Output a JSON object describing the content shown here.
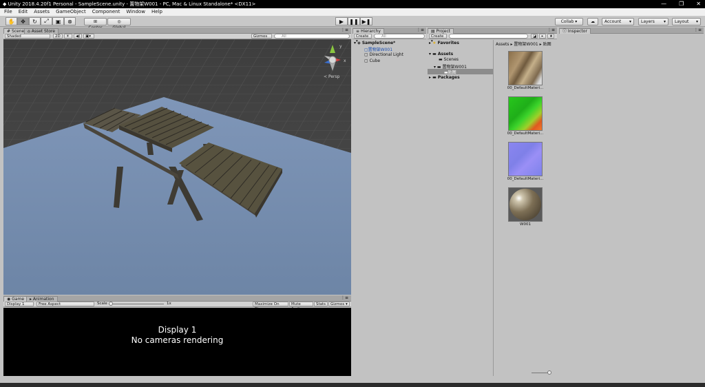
{
  "window": {
    "title": "Unity 2018.4.20f1 Personal - SampleScene.unity - 置物架W001 - PC, Mac & Linux Standalone* <DX11>"
  },
  "menu": [
    "File",
    "Edit",
    "Assets",
    "GameObject",
    "Component",
    "Window",
    "Help"
  ],
  "toolbar": {
    "pivot_label": "Center",
    "space_label": "Global",
    "collab_label": "Collab ▾",
    "account_label": "Account",
    "layers_label": "Layers",
    "layout_label": "Layout"
  },
  "scene": {
    "tab_label": "Scene",
    "asset_store_tab": "Asset Store",
    "shading_mode": "Shaded",
    "mode_2d": "2D",
    "gizmos_label": "Gizmos ▾",
    "search_placeholder": "All",
    "persp_label": "Persp"
  },
  "game": {
    "tab_label": "Game",
    "animation_tab": "Animation",
    "display_select": "Display 1",
    "aspect_select": "Free Aspect",
    "scale_label": "Scale",
    "scale_value": "1x",
    "maximize_label": "Maximize On Play",
    "mute_label": "Mute Audio",
    "stats_label": "Stats",
    "gizmos_label": "Gizmos",
    "message_line1": "Display 1",
    "message_line2": "No cameras rendering"
  },
  "hierarchy": {
    "tab_label": "Hierarchy",
    "create_label": "Create ▾",
    "search_placeholder": "All",
    "scene_name": "SampleScene*",
    "items": [
      "置物架W001",
      "Directional Light",
      "Cube"
    ]
  },
  "project": {
    "tab_label": "Project",
    "create_label": "Create ▾",
    "favorites_label": "Favorites",
    "assets_label": "Assets",
    "folders": [
      "Scenes",
      "置物架W001",
      "贴图"
    ],
    "packages_label": "Packages",
    "breadcrumb": [
      "Assets",
      "置物架W001",
      "贴图"
    ],
    "assets": [
      {
        "name": "00_DefaultMateri...",
        "kind": "texture-wood"
      },
      {
        "name": "00_DefaultMateri...",
        "kind": "texture-green"
      },
      {
        "name": "00_DefaultMateri...",
        "kind": "texture-normal"
      },
      {
        "name": "W001",
        "kind": "material-sphere"
      }
    ],
    "thumbnail_size_fraction": 0.8
  },
  "inspector": {
    "tab_label": "Inspector"
  },
  "colors": {
    "scene_ground": "#6f86a8",
    "scene_grid_dark": "#4a4a4a",
    "selection_blue": "#3a72d8",
    "panel_bg": "#c2c2c2"
  }
}
